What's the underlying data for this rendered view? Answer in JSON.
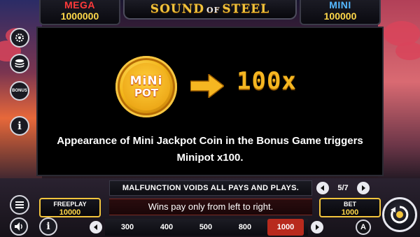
{
  "jackpots": {
    "mega": {
      "label": "MEGA",
      "value": "1000000"
    },
    "mini": {
      "label": "MINI",
      "value": "100000"
    }
  },
  "logo": {
    "part1": "SOUND",
    "part2": "OF",
    "part3": "STEEL"
  },
  "paytable": {
    "coin_line1": "MiNi",
    "coin_line2": "POT",
    "multiplier": "100x",
    "description": "Appearance of Mini Jackpot Coin in the Bonus Game triggers Minipot x100.",
    "page": "5/7"
  },
  "info": {
    "malfunction": "MALFUNCTION VOIDS ALL PAYS AND PLAYS.",
    "wins_rule": "Wins pay only from left to right."
  },
  "freeplay": {
    "label": "FREEPLAY",
    "value": "10000"
  },
  "bet": {
    "label": "BET",
    "value": "1000"
  },
  "bet_options": [
    "300",
    "400",
    "500",
    "800",
    "1000"
  ],
  "selected_bet": "1000",
  "side_buttons": {
    "bonus_label": "BONUS"
  },
  "auto_label": "A",
  "colors": {
    "accent_gold": "#f3c53d",
    "mega_red": "#ff3a3a",
    "mini_blue": "#55b8ff",
    "selected_bet": "#b82a1d"
  }
}
